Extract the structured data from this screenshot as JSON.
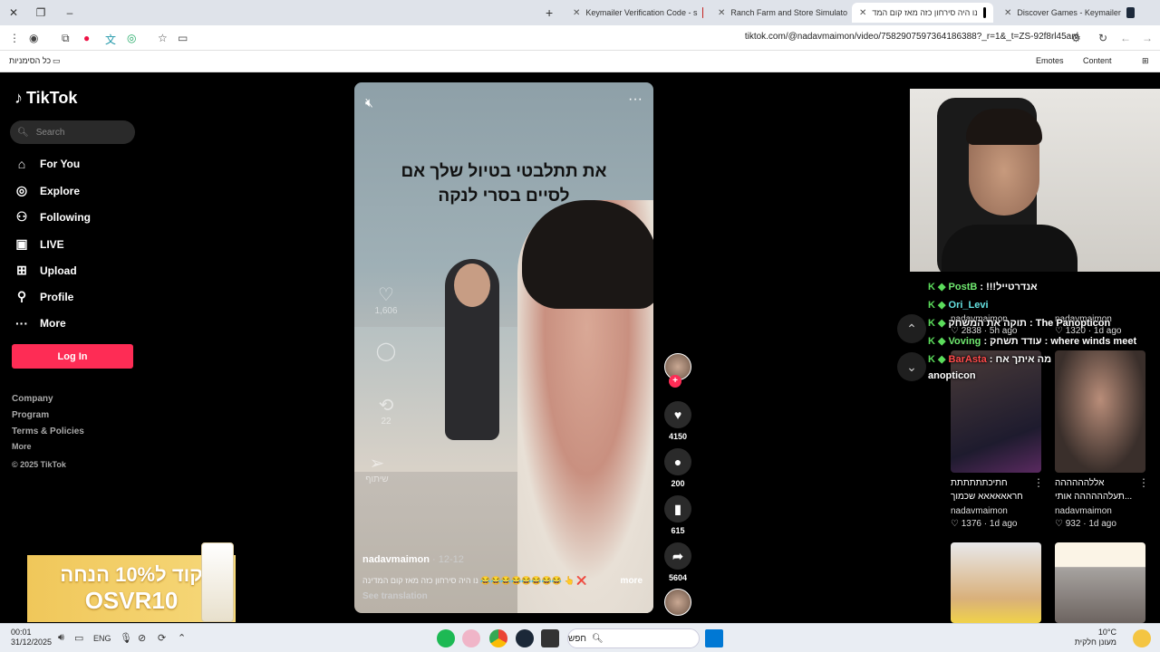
{
  "browser": {
    "tabs": [
      {
        "title": "Keymailer Verification Code - s",
        "active": false
      },
      {
        "title": "Ranch Farm and Store Simulato",
        "active": false
      },
      {
        "title": "נו היה סירחון כזה מאז קום המד",
        "active": true
      },
      {
        "title": "Discover Games - Keymailer",
        "active": false
      }
    ],
    "url": "tiktok.com/@nadavmaimon/video/7582907597364186388?_r=1&_t=ZS-92f8rl45anl",
    "bookmarks": {
      "all_bookmarks": "כל הסימניות",
      "emotes": "Emotes",
      "content": "Content"
    }
  },
  "sidebar": {
    "logo": "TikTok",
    "search_placeholder": "Search",
    "nav": [
      {
        "label": "For You",
        "icon": "home-icon"
      },
      {
        "label": "Explore",
        "icon": "compass-icon"
      },
      {
        "label": "Following",
        "icon": "following-icon"
      },
      {
        "label": "LIVE",
        "icon": "live-icon"
      },
      {
        "label": "Upload",
        "icon": "upload-icon"
      },
      {
        "label": "Profile",
        "icon": "profile-icon"
      },
      {
        "label": "More",
        "icon": "more-icon"
      }
    ],
    "login": "Log In",
    "footer": [
      "Company",
      "Program",
      "Terms & Policies",
      "More",
      "© 2025 TikTok"
    ]
  },
  "ad": {
    "line1": "קוד ל10% הנחה",
    "line2": "OSVR10"
  },
  "video": {
    "caption_line1": "את תתלבטי בטיול שלך אם",
    "caption_line2": "לסיים בסרי לנקה",
    "author": "nadavmaimon",
    "date": "· 12-12",
    "description": "נו היה סירחון כזה מאז קום המדינה 😂😂😂😂😂😂😂😂 👆 ❌",
    "more": "more",
    "see_translation": "See translation",
    "ghost_counts": {
      "likes": "1,606",
      "comments": "",
      "reposts": "22",
      "share": "שיתוף"
    }
  },
  "actions": {
    "likes": "4150",
    "comments": "200",
    "saves": "615",
    "shares": "5604"
  },
  "chat": [
    {
      "name": "PostB",
      "text": "!!!אנדרטייל"
    },
    {
      "name": "Ori_Levi",
      "text": ""
    },
    {
      "name": "",
      "text": "תוקה את המשחק : The Panopticon"
    },
    {
      "name": "Voving",
      "text": "עודד תשחק : where winds meet"
    },
    {
      "name": "BarAsta",
      "text": "מה איתך אח"
    },
    {
      "name": "",
      "text": "anopticon"
    }
  ],
  "grid": {
    "top_meta": [
      {
        "author": "nadavmaimon",
        "likes": "2838",
        "ago": "5h ago"
      },
      {
        "author": "nadavmaimon",
        "likes": "1320",
        "ago": "1d ago"
      }
    ],
    "cards": [
      {
        "caption1": "חתיכתתתתתת",
        "caption2": "חראאאאאא שכמוך",
        "author": "nadavmaimon",
        "likes": "1376",
        "ago": "1d ago"
      },
      {
        "caption1": "אללהההההה",
        "caption2": "תעלהההההה אותי...",
        "author": "nadavmaimon",
        "likes": "932",
        "ago": "1d ago"
      }
    ]
  },
  "taskbar": {
    "time": "00:01",
    "date": "31/12/2025",
    "lang": "ENG",
    "search": "חפש",
    "temp": "10°C",
    "weather": "מעונן חלקית"
  }
}
